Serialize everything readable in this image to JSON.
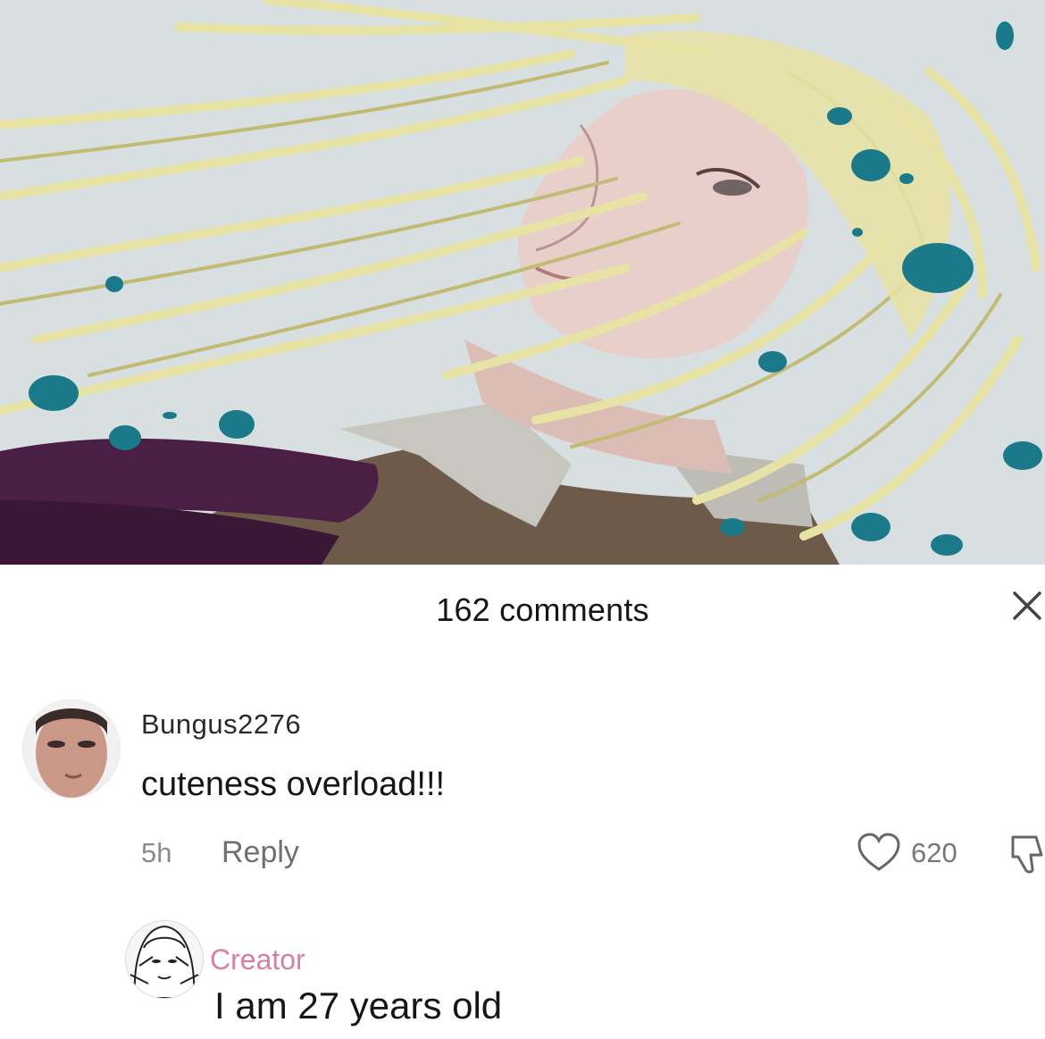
{
  "artwork": {
    "description_icon": "illustration-icon",
    "colors": {
      "background": "#d8dfe0",
      "hair": "#e7e3a5",
      "hair_shadow": "#c2bb72",
      "skin": "#e9cfc9",
      "splatter": "#1b7a8a",
      "scarf": "#4a1f45",
      "jacket": "#6e5a48",
      "collar": "#c7c7c0"
    }
  },
  "comments_panel": {
    "count_label": "162 comments",
    "close_icon": "close-icon"
  },
  "comments": [
    {
      "username": "Bungus2276",
      "text": "cuteness overload!!!",
      "time": "5h",
      "reply_label": "Reply",
      "likes": "620",
      "like_icon": "heart-icon",
      "dislike_icon": "thumbs-down-icon"
    },
    {
      "creator_label": "Creator",
      "text": "I am 27 years old"
    }
  ]
}
